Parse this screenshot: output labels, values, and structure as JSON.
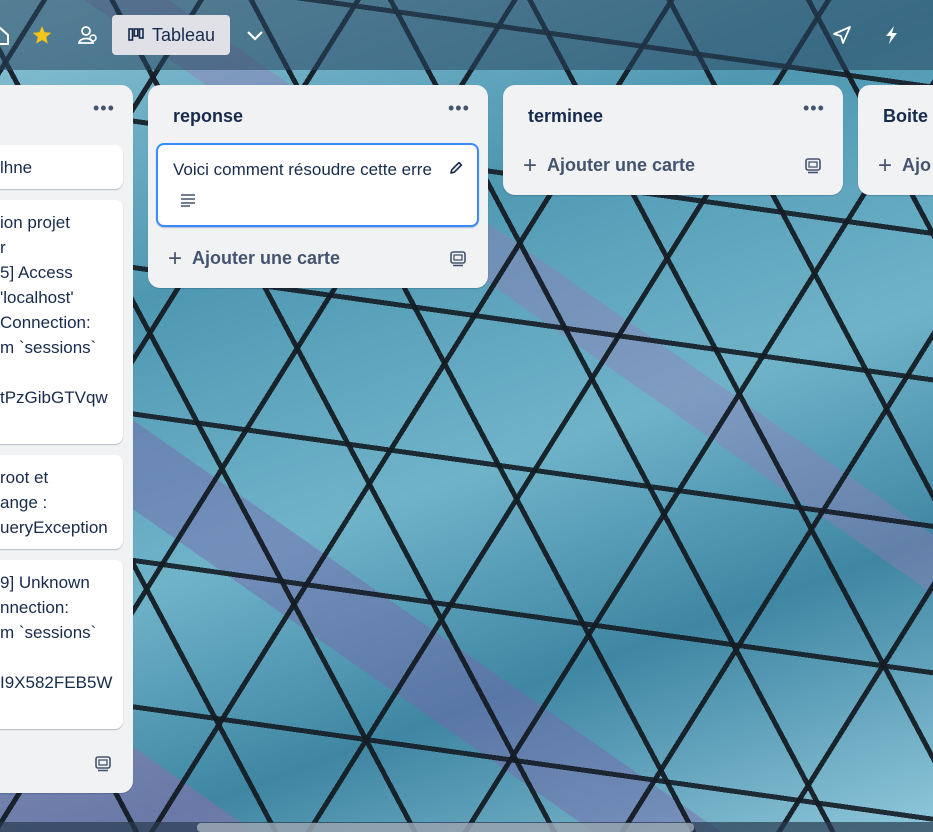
{
  "topbar": {
    "board_view_label": "Tableau",
    "icons": [
      "home-icon",
      "star-icon",
      "workspace-icon",
      "board-view-icon",
      "chevron-down-icon",
      "power-ups-icon",
      "automation-icon"
    ]
  },
  "lists": [
    {
      "title": "",
      "cards": [
        {
          "lines": [
            "lhne"
          ]
        },
        {
          "lines": [
            "ion projet",
            "r",
            "5] Access",
            "'localhost'",
            "Connection:",
            "m `sessions`",
            "",
            "tPzGibGTVqw"
          ]
        },
        {
          "lines": [
            "root et",
            "ange :",
            "ueryException"
          ]
        },
        {
          "lines": [
            "9] Unknown",
            "nnection:",
            "m `sessions`",
            "",
            "I9X582FEB5W"
          ]
        }
      ]
    },
    {
      "title": "reponse",
      "cards": [
        {
          "lines": [
            "Voici comment résoudre cette erre"
          ],
          "has_description": true
        }
      ],
      "add_card_label": "Ajouter une carte"
    },
    {
      "title": "terminee",
      "cards": [],
      "add_card_label": "Ajouter une carte"
    },
    {
      "title": "Boite à",
      "cards": [],
      "add_card_label": "Ajo"
    }
  ],
  "colors": {
    "list_bg": "#f1f2f4",
    "card_focus_border": "#388bff",
    "text": "#172b4d",
    "subtle_text": "#44546f"
  }
}
